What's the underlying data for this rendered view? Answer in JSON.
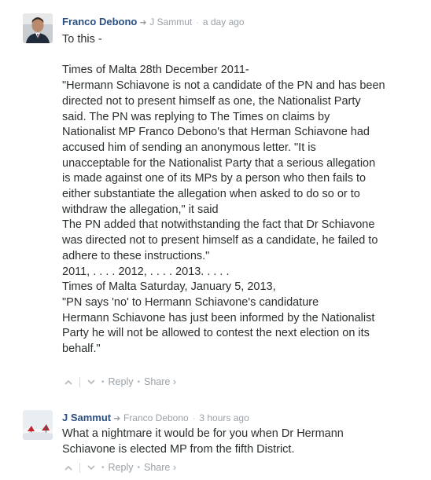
{
  "comments": [
    {
      "author": "Franco Debono",
      "reply_to": "J Sammut",
      "time": "a day ago",
      "lines": [
        "To this -",
        "",
        "Times of Malta 28th December 2011-",
        "\"Hermann Schiavone is not a candidate of the PN and has been",
        "directed not to present himself as one, the Nationalist Party",
        "said. The PN was replying to The Times on claims by",
        "Nationalist MP Franco Debono's that Herman Schiavone had",
        "accused him of sending an anonymous letter. \"It is",
        "unacceptable for the Nationalist Party that a serious allegation",
        "is made against one of its MPs by a person who then fails to",
        "either substantiate the allegation when asked to do so or to",
        "withdraw the allegation,\" it said",
        "The PN added that notwithstanding the fact that Dr Schiavone",
        "was directed not to present himself as a candidate, he failed to",
        "adhere to these instructions.\"",
        "2011, . . . . 2012, . . . . 2013. . . . .",
        "Times of Malta Saturday, January 5, 2013,",
        "\"PN says 'no' to Hermann Schiavone's candidature",
        "Hermann Schiavone has just been informed by the Nationalist",
        "Party he will not be allowed to contest the next election on its",
        "behalf.\""
      ],
      "reply_label": "Reply",
      "share_label": "Share ›"
    },
    {
      "author": "J Sammut",
      "reply_to": "Franco Debono",
      "time": "3 hours ago",
      "lines": [
        "What a nightmare it would be for you when Dr Hermann",
        "Schiavone is elected MP from the fifth District."
      ],
      "reply_label": "Reply",
      "share_label": "Share ›"
    }
  ],
  "icons": {
    "reply_arrow": "reply-arrow-icon",
    "upvote": "chevron-up-icon",
    "downvote": "chevron-down-icon"
  },
  "colors": {
    "author": "#2a4f83",
    "meta": "#9aa1a7",
    "text": "#2a2e2e"
  }
}
